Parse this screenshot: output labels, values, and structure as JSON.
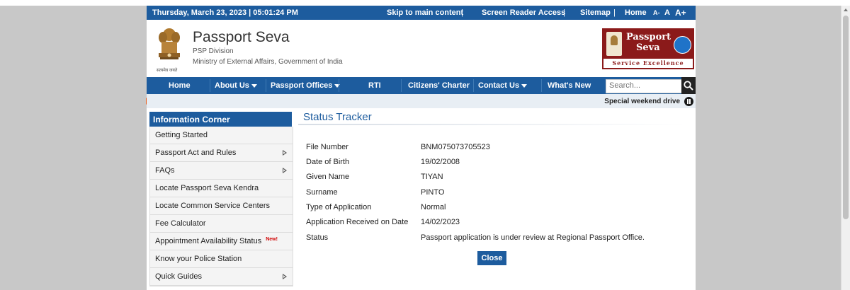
{
  "utility_bar": {
    "datetime": "Thursday,  March  23, 2023 | 05:01:24 PM",
    "skip": "Skip to main content",
    "screen_reader": "Screen Reader Access",
    "sitemap": "Sitemap",
    "home": "Home",
    "font_small": "A-",
    "font_normal": "A",
    "font_large": "A+",
    "separator": "|"
  },
  "header": {
    "title": "Passport Seva",
    "division": "PSP Division",
    "ministry": "Ministry of External Affairs, Government of India",
    "emblem_motto": "सत्यमेव जयते",
    "logo_line1": "Passport",
    "logo_line2": "Seva",
    "logo_tagline": "Service Excellence"
  },
  "nav": {
    "items": [
      {
        "label": "Home",
        "dropdown": false
      },
      {
        "label": "About Us",
        "dropdown": true
      },
      {
        "label": "Passport Offices",
        "dropdown": true
      },
      {
        "label": "RTI",
        "dropdown": false
      },
      {
        "label": "Citizens' Charter",
        "dropdown": false
      },
      {
        "label": "Contact Us",
        "dropdown": true
      },
      {
        "label": "What's New",
        "dropdown": false
      }
    ],
    "search_placeholder": "Search..."
  },
  "ticker": {
    "text": "Special weekend drive"
  },
  "sidebar": {
    "title": "Information Corner",
    "items": [
      {
        "label": "Getting Started",
        "submenu": false
      },
      {
        "label": "Passport Act and Rules",
        "submenu": true
      },
      {
        "label": "FAQs",
        "submenu": true
      },
      {
        "label": "Locate Passport Seva Kendra",
        "submenu": false
      },
      {
        "label": "Locate Common Service Centers",
        "submenu": false
      },
      {
        "label": "Fee Calculator",
        "submenu": false
      },
      {
        "label": "Appointment Availability Status",
        "submenu": false,
        "badge": "New!"
      },
      {
        "label": "Know your Police Station",
        "submenu": false
      },
      {
        "label": "Quick Guides",
        "submenu": true
      }
    ]
  },
  "main": {
    "title": "Status Tracker",
    "fields": [
      {
        "label": "File Number",
        "value": "BNM075073705523"
      },
      {
        "label": "Date of Birth",
        "value": "19/02/2008"
      },
      {
        "label": "Given Name",
        "value": "TIYAN"
      },
      {
        "label": "Surname",
        "value": "PINTO"
      },
      {
        "label": "Type of Application",
        "value": "Normal"
      },
      {
        "label": "Application Received on Date",
        "value": "14/02/2023"
      },
      {
        "label": "Status",
        "value": "Passport application is under review at Regional Passport Office."
      }
    ],
    "close_label": "Close"
  },
  "colors": {
    "primary": "#1d5c9e",
    "logo_maroon": "#8b1a1a",
    "accent_orange": "#e85d1a"
  }
}
